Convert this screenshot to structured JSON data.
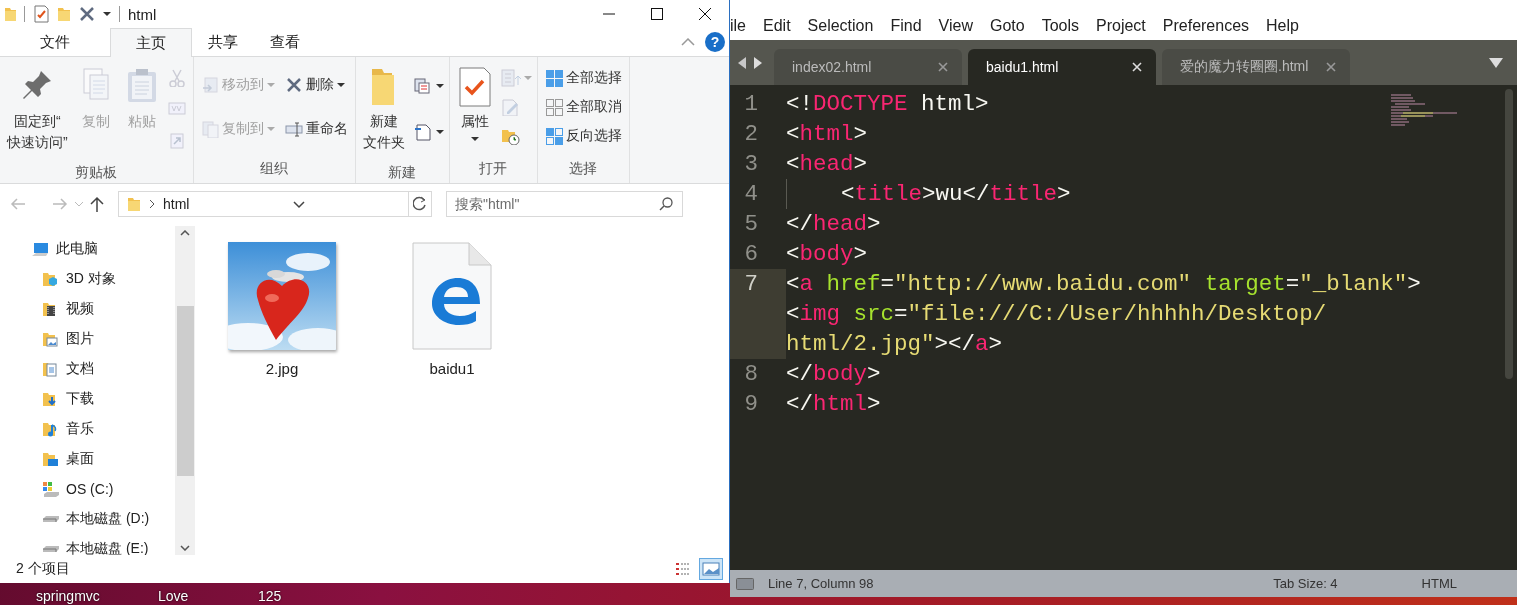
{
  "explorer": {
    "title": "html",
    "tabs": [
      {
        "label": "文件",
        "kind": "file",
        "selected": false
      },
      {
        "label": "主页",
        "kind": "tab",
        "selected": true
      },
      {
        "label": "共享",
        "kind": "tab",
        "selected": false
      },
      {
        "label": "查看",
        "kind": "tab",
        "selected": false
      }
    ],
    "help": "?",
    "ribbon": [
      {
        "label": "剪贴板",
        "columns": [
          [
            {
              "kind": "large",
              "lines": [
                "固定到“",
                "快速访问”"
              ],
              "disabled": false
            }
          ],
          [
            {
              "kind": "large",
              "lines": [
                "复制"
              ],
              "disabled": true
            }
          ],
          [
            {
              "kind": "large",
              "lines": [
                "粘贴"
              ],
              "disabled": true
            }
          ],
          [
            {
              "kind": "icon",
              "disabled": true
            },
            {
              "kind": "icon",
              "disabled": true
            },
            {
              "kind": "icon",
              "disabled": true
            }
          ]
        ]
      },
      {
        "label": "组织",
        "columns": [
          [
            {
              "kind": "small",
              "label": "移动到",
              "disabled": true,
              "dropdown": true
            },
            {
              "kind": "small",
              "label": "复制到",
              "disabled": true,
              "dropdown": true
            }
          ],
          [
            {
              "kind": "small",
              "label": "删除",
              "disabled": false,
              "dropdown": true
            },
            {
              "kind": "small",
              "label": "重命名",
              "disabled": false
            }
          ]
        ]
      },
      {
        "label": "新建",
        "columns": [
          [
            {
              "kind": "large",
              "lines": [
                "新建",
                "文件夹"
              ],
              "disabled": false
            }
          ],
          [
            {
              "kind": "icon",
              "disabled": false,
              "dropdown": true
            },
            {
              "kind": "icon",
              "disabled": false,
              "dropdown": true
            }
          ]
        ]
      },
      {
        "label": "打开",
        "columns": [
          [
            {
              "kind": "large",
              "lines": [
                "属性"
              ],
              "disabled": false,
              "dropdown": true
            }
          ],
          [
            {
              "kind": "icon",
              "disabled": true,
              "dropdown": true
            },
            {
              "kind": "icon",
              "disabled": true
            },
            {
              "kind": "icon",
              "disabled": false
            }
          ]
        ]
      },
      {
        "label": "选择",
        "columns": [
          [
            {
              "kind": "small",
              "label": "全部选择",
              "disabled": false
            },
            {
              "kind": "small",
              "label": "全部取消",
              "disabled": false
            },
            {
              "kind": "small",
              "label": "反向选择",
              "disabled": false
            }
          ]
        ]
      }
    ],
    "address": {
      "path": "html"
    },
    "search": {
      "placeholder": "搜索\"html\""
    },
    "nav": [
      {
        "label": "此电脑",
        "children": [
          {
            "label": "3D 对象"
          },
          {
            "label": "视频"
          },
          {
            "label": "图片"
          },
          {
            "label": "文档"
          },
          {
            "label": "下载"
          },
          {
            "label": "音乐"
          },
          {
            "label": "桌面"
          },
          {
            "label": "OS (C:)"
          },
          {
            "label": "本地磁盘 (D:)"
          },
          {
            "label": "本地磁盘 (E:)"
          }
        ]
      }
    ],
    "files": [
      {
        "name": "2.jpg",
        "kind": "picture"
      },
      {
        "name": "baidu1",
        "kind": "document"
      }
    ],
    "status": "2 个项目",
    "views": [
      {
        "selected": false
      },
      {
        "selected": true
      }
    ]
  },
  "editor": {
    "menu": [
      "ile",
      "Edit",
      "Selection",
      "Find",
      "View",
      "Goto",
      "Tools",
      "Project",
      "Preferences",
      "Help"
    ],
    "tabs": [
      {
        "label": "index02.html",
        "selected": false
      },
      {
        "label": "baidu1.html",
        "selected": true
      },
      {
        "label": "爱的魔力转圈圈.html",
        "selected": false
      }
    ],
    "lines": [
      {
        "number": "1",
        "current": false,
        "rows": [
          {
            "tokens": [
              {
                "kind": "punct",
                "text": "<!"
              },
              {
                "kind": "tag",
                "text": "DOCTYPE"
              },
              {
                "kind": "text",
                "text": " html"
              },
              {
                "kind": "punct",
                "text": ">"
              }
            ]
          }
        ]
      },
      {
        "number": "2",
        "current": false,
        "rows": [
          {
            "tokens": [
              {
                "kind": "punct",
                "text": "<"
              },
              {
                "kind": "tag",
                "text": "html"
              },
              {
                "kind": "punct",
                "text": ">"
              }
            ]
          }
        ]
      },
      {
        "number": "3",
        "current": false,
        "rows": [
          {
            "tokens": [
              {
                "kind": "punct",
                "text": "<"
              },
              {
                "kind": "tag",
                "text": "head"
              },
              {
                "kind": "punct",
                "text": ">"
              }
            ]
          }
        ]
      },
      {
        "number": "4",
        "current": false,
        "indent": true,
        "rows": [
          {
            "tokens": [
              {
                "kind": "punct",
                "text": "<"
              },
              {
                "kind": "tag",
                "text": "title"
              },
              {
                "kind": "punct",
                "text": ">wu</"
              },
              {
                "kind": "tag",
                "text": "title"
              },
              {
                "kind": "punct",
                "text": ">"
              }
            ]
          }
        ]
      },
      {
        "number": "5",
        "current": false,
        "rows": [
          {
            "tokens": [
              {
                "kind": "punct",
                "text": "</"
              },
              {
                "kind": "tag",
                "text": "head"
              },
              {
                "kind": "punct",
                "text": ">"
              }
            ]
          }
        ]
      },
      {
        "number": "6",
        "current": false,
        "rows": [
          {
            "tokens": [
              {
                "kind": "punct",
                "text": "<"
              },
              {
                "kind": "tag",
                "text": "body"
              },
              {
                "kind": "punct",
                "text": ">"
              }
            ]
          }
        ]
      },
      {
        "number": "7",
        "current": true,
        "rows": [
          {
            "tokens": [
              {
                "kind": "punct",
                "text": "<"
              },
              {
                "kind": "tag",
                "text": "a"
              },
              {
                "kind": "attr",
                "text": " href"
              },
              {
                "kind": "punct",
                "text": "="
              },
              {
                "kind": "string",
                "text": "\"http://www.baidu.com\""
              },
              {
                "kind": "attr",
                "text": " target"
              },
              {
                "kind": "punct",
                "text": "="
              },
              {
                "kind": "string",
                "text": "\"_blank\""
              },
              {
                "kind": "punct",
                "text": ">"
              }
            ]
          },
          {
            "tokens": [
              {
                "kind": "punct",
                "text": "<"
              },
              {
                "kind": "tag",
                "text": "img"
              },
              {
                "kind": "attr",
                "text": " src"
              },
              {
                "kind": "punct",
                "text": "="
              },
              {
                "kind": "string",
                "text": "\"file:///C:/User/hhhhh/Desktop/"
              }
            ]
          },
          {
            "tokens": [
              {
                "kind": "string",
                "text": "html/2.jpg\""
              },
              {
                "kind": "punct",
                "text": "></"
              },
              {
                "kind": "tag",
                "text": "a"
              },
              {
                "kind": "punct",
                "text": ">"
              }
            ]
          }
        ]
      },
      {
        "number": "8",
        "current": false,
        "rows": [
          {
            "tokens": [
              {
                "kind": "punct",
                "text": "</"
              },
              {
                "kind": "tag",
                "text": "body"
              },
              {
                "kind": "punct",
                "text": ">"
              }
            ]
          }
        ]
      },
      {
        "number": "9",
        "current": false,
        "rows": [
          {
            "tokens": [
              {
                "kind": "punct",
                "text": "</"
              },
              {
                "kind": "tag",
                "text": "html"
              },
              {
                "kind": "punct",
                "text": ">"
              }
            ]
          }
        ]
      }
    ],
    "status": {
      "position": "Line 7, Column 98",
      "tab_size": "Tab Size: 4",
      "syntax": "HTML"
    }
  },
  "desktop": {
    "labels": [
      "springmvc",
      "Love",
      "125"
    ]
  }
}
